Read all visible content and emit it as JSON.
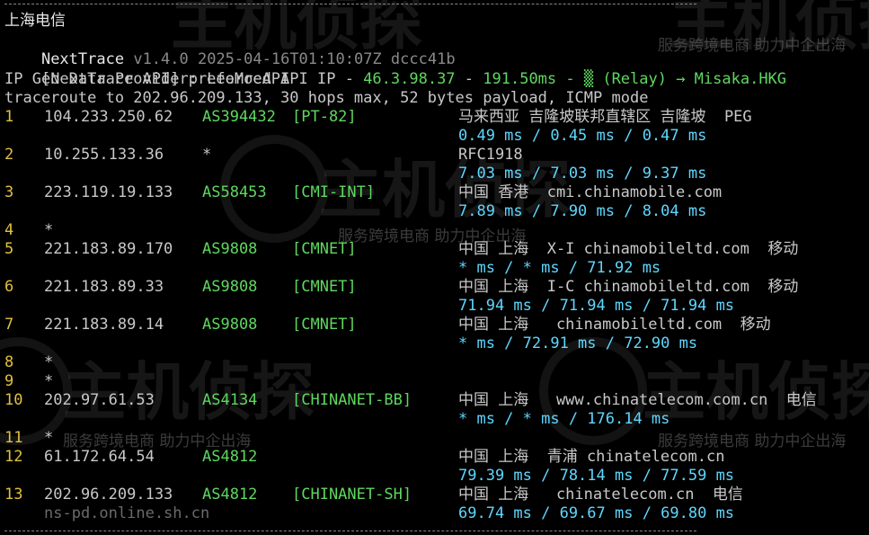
{
  "watermark": {
    "logo_text": "主机侦探",
    "tagline": "服务跨境电商 助力中企出海"
  },
  "header": {
    "location": "上海电信",
    "version_prefix": "NextTrace",
    "version_rest": "v1.4.0 2025-04-16T01:10:07Z dccc41b",
    "api_label": "[NextTrace API] preferred API IP - ",
    "api_ip": "46.3.98.37",
    "api_sep": " - ",
    "api_latency": "191.50ms",
    "api_relay": " - ▒ (Relay) → Misaka.HKG",
    "geo_provider": "IP Geo Data Provider: LeoMoeAPI",
    "traceroute": "traceroute to 202.96.209.133, 30 hops max, 52 bytes payload, ICMP mode"
  },
  "hops": [
    {
      "n": "1",
      "ip": "104.233.250.62",
      "as": "AS394432",
      "tag": "[PT-82]",
      "geo": "马来西亚 吉隆坡联邦直辖区 吉隆坡  PEG",
      "rtt": "0.49 ms / 0.45 ms / 0.47 ms"
    },
    {
      "n": "2",
      "ip": "10.255.133.36",
      "as": "*",
      "tag": "",
      "geo": "RFC1918",
      "rtt": "7.03 ms / 7.03 ms / 9.37 ms"
    },
    {
      "n": "3",
      "ip": "223.119.19.133",
      "as": "AS58453",
      "tag": "[CMI-INT]",
      "geo": "中国 香港  cmi.chinamobile.com",
      "rtt": "7.89 ms / 7.90 ms / 8.04 ms"
    },
    {
      "n": "4",
      "ip": "*",
      "as": "",
      "tag": "",
      "geo": "",
      "rtt": ""
    },
    {
      "n": "5",
      "ip": "221.183.89.170",
      "as": "AS9808",
      "tag": "[CMNET]",
      "geo": "中国 上海  X-I chinamobileltd.com  移动",
      "rtt": "* ms / * ms / 71.92 ms"
    },
    {
      "n": "6",
      "ip": "221.183.89.33",
      "as": "AS9808",
      "tag": "[CMNET]",
      "geo": "中国 上海  I-C chinamobileltd.com  移动",
      "rtt": "71.94 ms / 71.94 ms / 71.94 ms"
    },
    {
      "n": "7",
      "ip": "221.183.89.14",
      "as": "AS9808",
      "tag": "[CMNET]",
      "geo": "中国 上海   chinamobileltd.com  移动",
      "rtt": "* ms / 72.91 ms / 72.90 ms"
    },
    {
      "n": "8",
      "ip": "*",
      "as": "",
      "tag": "",
      "geo": "",
      "rtt": ""
    },
    {
      "n": "9",
      "ip": "*",
      "as": "",
      "tag": "",
      "geo": "",
      "rtt": ""
    },
    {
      "n": "10",
      "ip": "202.97.61.53",
      "as": "AS4134",
      "tag": "[CHINANET-BB]",
      "geo": "中国 上海   www.chinatelecom.com.cn  电信",
      "rtt": "* ms / * ms / 176.14 ms"
    },
    {
      "n": "11",
      "ip": "*",
      "as": "",
      "tag": "",
      "geo": "",
      "rtt": ""
    },
    {
      "n": "12",
      "ip": "61.172.64.54",
      "as": "AS4812",
      "tag": "",
      "geo": "中国 上海  青浦 chinatelecom.cn",
      "rtt": "79.39 ms / 78.14 ms / 77.59 ms"
    },
    {
      "n": "13",
      "ip": "202.96.209.133",
      "as": "AS4812",
      "tag": "[CHINANET-SH]",
      "geo": "中国 上海   chinatelecom.cn  电信",
      "rtt": "69.74 ms / 69.67 ms / 69.80 ms",
      "rdns": "ns-pd.online.sh.cn"
    }
  ],
  "colors": {
    "background": "#000000",
    "as_green": "#5fd75f",
    "rtt_cyan": "#5fd7ff",
    "hop_yellow": "#e0c040"
  }
}
